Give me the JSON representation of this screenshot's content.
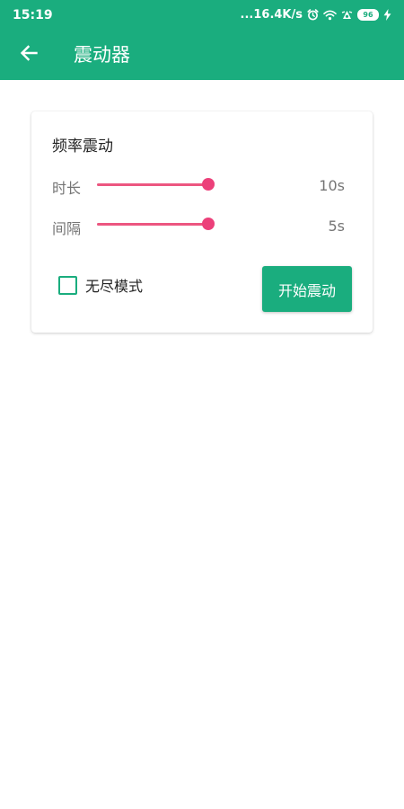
{
  "status_bar": {
    "time": "15:19",
    "network_speed": "...16.4K/s",
    "battery_level": "96",
    "icons": [
      "alarm-icon",
      "wifi-icon",
      "notification-icon",
      "battery-icon",
      "charging-icon"
    ]
  },
  "app_bar": {
    "title": "震动器",
    "back_icon": "arrow-left-icon"
  },
  "card": {
    "title": "频率震动",
    "duration": {
      "label": "时长",
      "value": "10s",
      "level": 1.0
    },
    "interval": {
      "label": "间隔",
      "value": "5s",
      "level": 1.0
    },
    "endless_mode": {
      "label": "无尽模式",
      "checked": false
    },
    "start_button_label": "开始震动"
  },
  "colors": {
    "primary": "#1aad7e",
    "accent": "#ec407a",
    "text_secondary": "#757575"
  }
}
